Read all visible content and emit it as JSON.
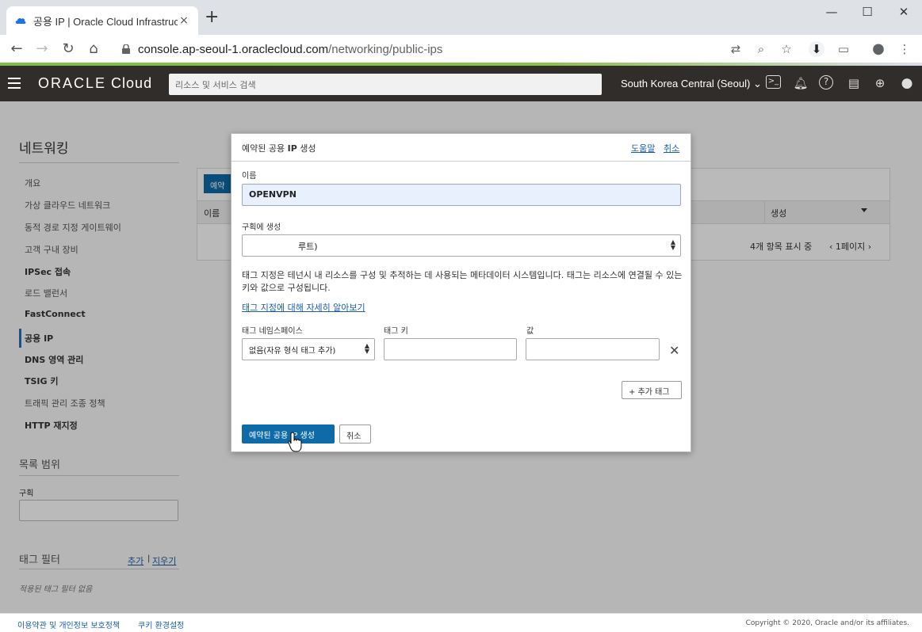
{
  "browser": {
    "tab_title": "공용 IP | Oracle Cloud Infrastruc",
    "tab_close": "×",
    "new_tab": "+",
    "url_host": "console.ap-seoul-1.oraclecloud.com",
    "url_path": "/networking/public-ips",
    "window_controls": {
      "minimize": "—",
      "maximize": "☐",
      "close": "✕"
    }
  },
  "header": {
    "logo_oracle": "ORACLE",
    "logo_cloud": "Cloud",
    "search_placeholder": "리소스 및 서비스 검색",
    "region": "South Korea Central (Seoul)"
  },
  "sidebar": {
    "title": "네트워킹",
    "items": [
      {
        "label": "개요"
      },
      {
        "label": "가상 클라우드 네트워크"
      },
      {
        "label": "동적 경로 지정 게이트웨이"
      },
      {
        "label": "고객 구내 장비"
      },
      {
        "label": "IPSec 접속"
      },
      {
        "label": "로드 밸런서"
      },
      {
        "label": "FastConnect"
      },
      {
        "label": "공용 IP"
      },
      {
        "label": "DNS 영역 관리"
      },
      {
        "label": "TSIG 키"
      },
      {
        "label": "트래픽 관리 조종 정책"
      },
      {
        "label": "HTTP 재지정"
      }
    ],
    "list_scope_title": "목록 범위",
    "compartment_label": "구획",
    "tag_filter_title": "태그 필터",
    "tag_add": "추가",
    "tag_separator": "|",
    "tag_clear": "지우기",
    "no_tag_filters": "적용된 태그 필터 없음"
  },
  "background_table": {
    "create_button": "예약된 공용 IP 생성",
    "col_name": "이름",
    "col_created": "생성",
    "count_text": "4개 항목 표시 중",
    "page_text": "1페이지"
  },
  "modal": {
    "title_prefix": "예약된 공용",
    "title_bold": "IP",
    "title_suffix": "생성",
    "help_link": "도움말",
    "cancel_link": "취소",
    "name_label": "이름",
    "name_value": "OPENVPN",
    "compartment_label": "구획에 생성",
    "compartment_value": "루트)",
    "tag_description": "태그 지정은 테넌시 내 리소스를 구성 및 추적하는 데 사용되는 메타데이터 시스템입니다. 태그는 리소스에 연결될 수 있는 키와 값으로 구성됩니다.",
    "tag_learn_more": "태그 지정에 대해 자세히 알아보기",
    "tag_namespace_label": "태그 네임스페이스",
    "tag_namespace_value": "없음(자유 형식 태그 추가)",
    "tag_key_label": "태그 키",
    "tag_value_label": "값",
    "tag_key_value": "",
    "tag_value_value": "",
    "remove_tag": "✕",
    "add_tag_button": "+ 추가 태그",
    "primary_button": "예약된 공용 IP 생성",
    "secondary_button": "취소"
  },
  "footer": {
    "terms": "이용약관 및 개인정보 보호정책",
    "cookies": "쿠키 환경설정",
    "copyright": "Copyright © 2020, Oracle and/or its affiliates."
  },
  "colors": {
    "oracle_header": "#312d2a",
    "primary_button": "#0f6aa8",
    "link": "#1a5ea8",
    "overlay": "rgba(0,0,0,0.27)"
  }
}
